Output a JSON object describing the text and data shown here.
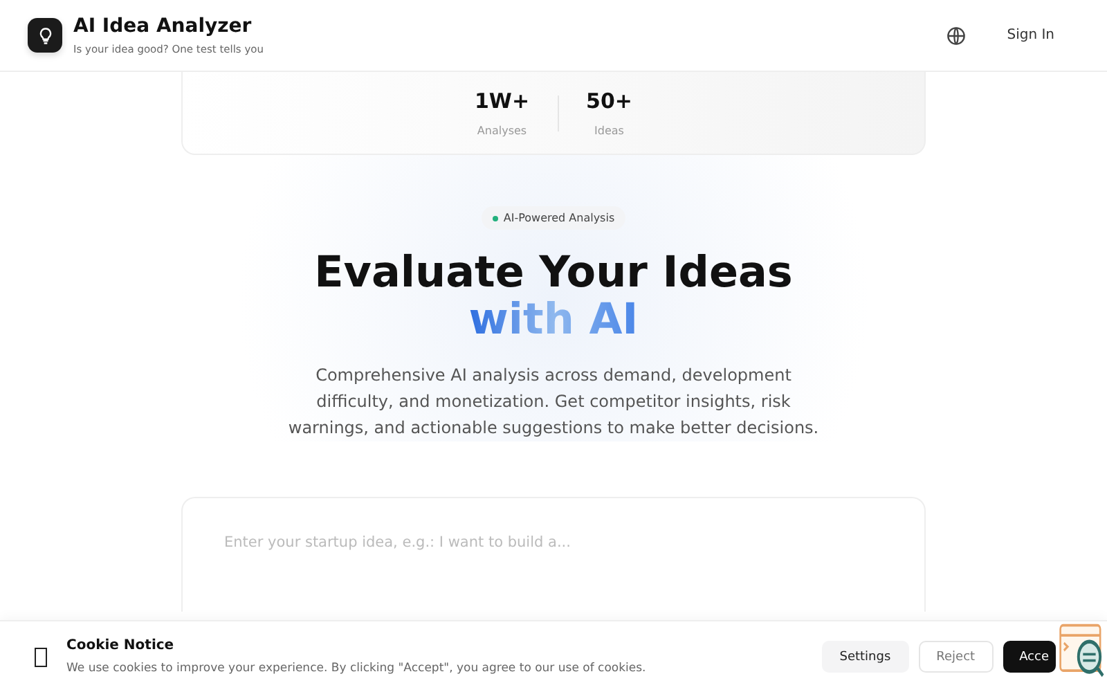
{
  "header": {
    "title": "AI Idea Analyzer",
    "subtitle": "Is your idea good? One test tells you",
    "sign_in": "Sign In"
  },
  "stats": [
    {
      "value": "1W+",
      "label": "Analyses"
    },
    {
      "value": "50+",
      "label": "Ideas"
    }
  ],
  "badge": {
    "label": "AI-Powered Analysis",
    "color": "#22b07d"
  },
  "headline": {
    "line_1": "Evaluate Your Ideas",
    "line_2": "with AI"
  },
  "description": "Comprehensive AI analysis across demand, development difficulty, and monetization. Get competitor insights, risk warnings, and actionable suggestions to make better decisions.",
  "idea_input": {
    "placeholder": "Enter your startup idea, e.g.: I want to build a..."
  },
  "cookie_notice": {
    "title": "Cookie Notice",
    "text": "We use cookies to improve your experience. By clicking \"Accept\", you agree to our use of cookies.",
    "buttons": [
      {
        "label": "Settings",
        "kind": "secondary"
      },
      {
        "label": "Reject",
        "kind": "outline"
      },
      {
        "label": "Acce",
        "kind": "primary"
      }
    ]
  }
}
